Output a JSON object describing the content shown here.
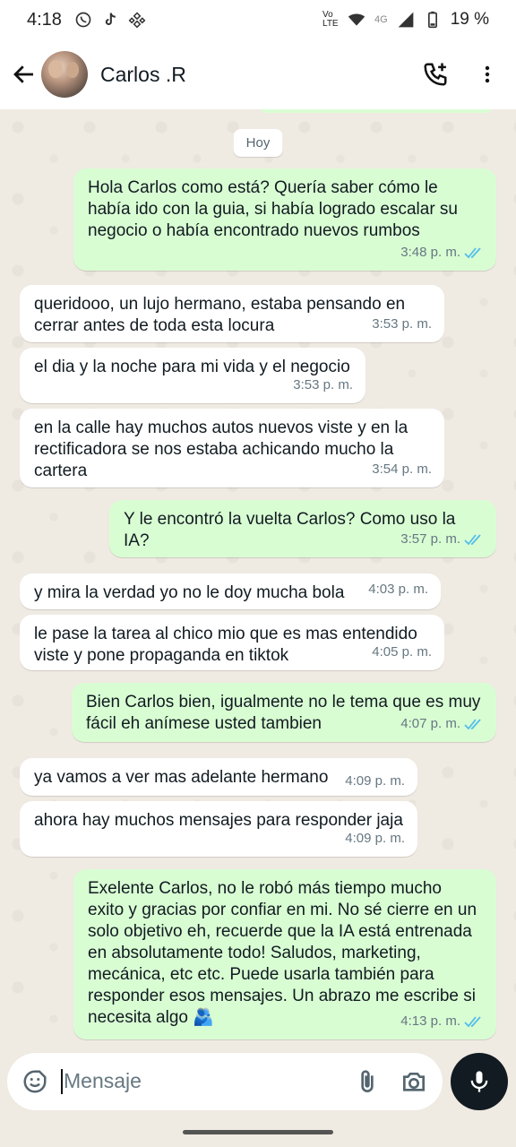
{
  "status_bar": {
    "time": "4:18",
    "network": "4G",
    "volte": "Vo LTE",
    "battery": "19 %"
  },
  "header": {
    "contact_name": "Carlos .R",
    "icons": [
      "back-arrow-icon",
      "add-call-icon",
      "more-vert-icon"
    ]
  },
  "chat": {
    "day_label": "Hoy",
    "messages": [
      {
        "dir": "out",
        "text": "Hola Carlos como está? Quería saber cómo le había ido con la guia, si había logrado escalar su negocio o había encontrado nuevos rumbos",
        "time": "3:48 p. m."
      },
      {
        "dir": "in",
        "text": "queridooo, un lujo hermano, estaba pensando en cerrar antes de toda esta locura",
        "time": "3:53 p. m."
      },
      {
        "dir": "in",
        "text": "el dia y la noche para mi vida y el negocio",
        "time": "3:53 p. m."
      },
      {
        "dir": "in",
        "text": "en la calle hay muchos autos nuevos viste y en la rectificadora se nos estaba achicando mucho la cartera",
        "time": "3:54 p. m."
      },
      {
        "dir": "out",
        "text": "Y le encontró la vuelta Carlos? Como uso la IA?",
        "time": "3:57 p. m."
      },
      {
        "dir": "in",
        "text": "y mira la verdad yo no le doy mucha bola",
        "time": "4:03 p. m."
      },
      {
        "dir": "in",
        "text": "le pase la tarea al chico mio que es mas entendido viste y pone propaganda en tiktok",
        "time": "4:05 p. m."
      },
      {
        "dir": "out",
        "text": "Bien Carlos bien, igualmente no le tema que es muy fácil eh anímese usted tambien",
        "time": "4:07 p. m."
      },
      {
        "dir": "in",
        "text": "ya vamos a ver mas adelante hermano",
        "time": "4:09 p. m."
      },
      {
        "dir": "in",
        "text": "ahora hay muchos mensajes para responder jaja",
        "time": "4:09 p. m."
      },
      {
        "dir": "out",
        "text": "Exelente Carlos, no le robó más tiempo mucho exito y gracias por confiar en mi. No sé cierre en un solo objetivo eh, recuerde que la IA está entrenada en absolutamente todo! Saludos, marketing, mecánica, etc etc. Puede usarla también para responder esos mensajes. Un abrazo me escribe si necesita algo 🫂",
        "time": "4:13 p. m."
      }
    ]
  },
  "composer": {
    "placeholder": "Mensaje"
  },
  "colors": {
    "outgoing_bubble": "#d9fdd3",
    "incoming_bubble": "#ffffff",
    "chat_bg": "#efeae2",
    "read_ticks": "#53bdeb",
    "mic_button": "#111b21"
  }
}
